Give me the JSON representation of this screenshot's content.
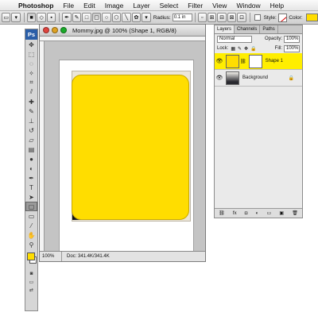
{
  "menubar": {
    "apple": "",
    "items": [
      "Photoshop",
      "File",
      "Edit",
      "Image",
      "Layer",
      "Select",
      "Filter",
      "View",
      "Window",
      "Help"
    ]
  },
  "options": {
    "radius_label": "Radius:",
    "radius_value": "0.1 in",
    "style_label": "Style:",
    "color_label": "Color:",
    "color_hex": "#ffdd00"
  },
  "tools": {
    "logo": "Ps",
    "foreground_color": "#ffdd00",
    "background_color": "#ffffff"
  },
  "document": {
    "title": "Mommy.jpg @ 100% (Shape 1, RGB/8)",
    "zoom": "100%",
    "doc_info": "Doc: 341.4K/341.4K",
    "shape_color": "#ffdd00"
  },
  "layers_panel": {
    "tabs": [
      "Layers",
      "Channels",
      "Paths"
    ],
    "blend_mode": "Normal",
    "opacity_label": "Opacity:",
    "opacity_value": "100%",
    "lock_label": "Lock:",
    "fill_label": "Fill:",
    "fill_value": "100%",
    "layers": [
      {
        "name": "Shape 1",
        "active": true
      },
      {
        "name": "Background",
        "active": false
      }
    ],
    "footer_icons": [
      "link-icon",
      "fx-icon",
      "mask-icon",
      "adjustment-icon",
      "group-icon",
      "new-layer-icon",
      "trash-icon"
    ]
  }
}
